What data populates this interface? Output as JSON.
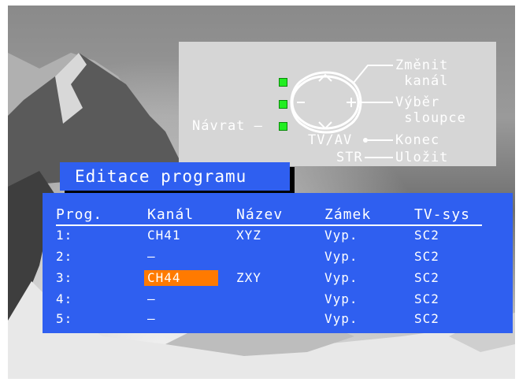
{
  "help_panel": {
    "change_channel": "Změnit\n kanál",
    "select_column": "Výběr\n sloupce",
    "exit": "Konec",
    "save": "Uložit",
    "back": "Návrat –",
    "tv_av": "TV/AV",
    "str": "STR"
  },
  "title": "Editace programu",
  "table": {
    "headers": [
      "Prog.",
      "Kanál",
      "Název",
      "Zámek",
      "TV-sys"
    ],
    "rows": [
      [
        "1:",
        "CH41",
        "XYZ",
        "Vyp.",
        "SC2"
      ],
      [
        "2:",
        "–",
        "",
        "Vyp.",
        "SC2"
      ],
      [
        "3:",
        "CH44",
        "ZXY",
        "Vyp.",
        "SC2"
      ],
      [
        "4:",
        "–",
        "",
        "Vyp.",
        "SC2"
      ],
      [
        "5:",
        "–",
        "",
        "Vyp.",
        "SC2"
      ]
    ],
    "selected_row": 3
  },
  "colors": {
    "panel_blue": "#2f5ff0",
    "highlight_orange": "#ff7a00",
    "led_green": "#22ee22",
    "help_panel_gray": "#d6d6d6"
  }
}
